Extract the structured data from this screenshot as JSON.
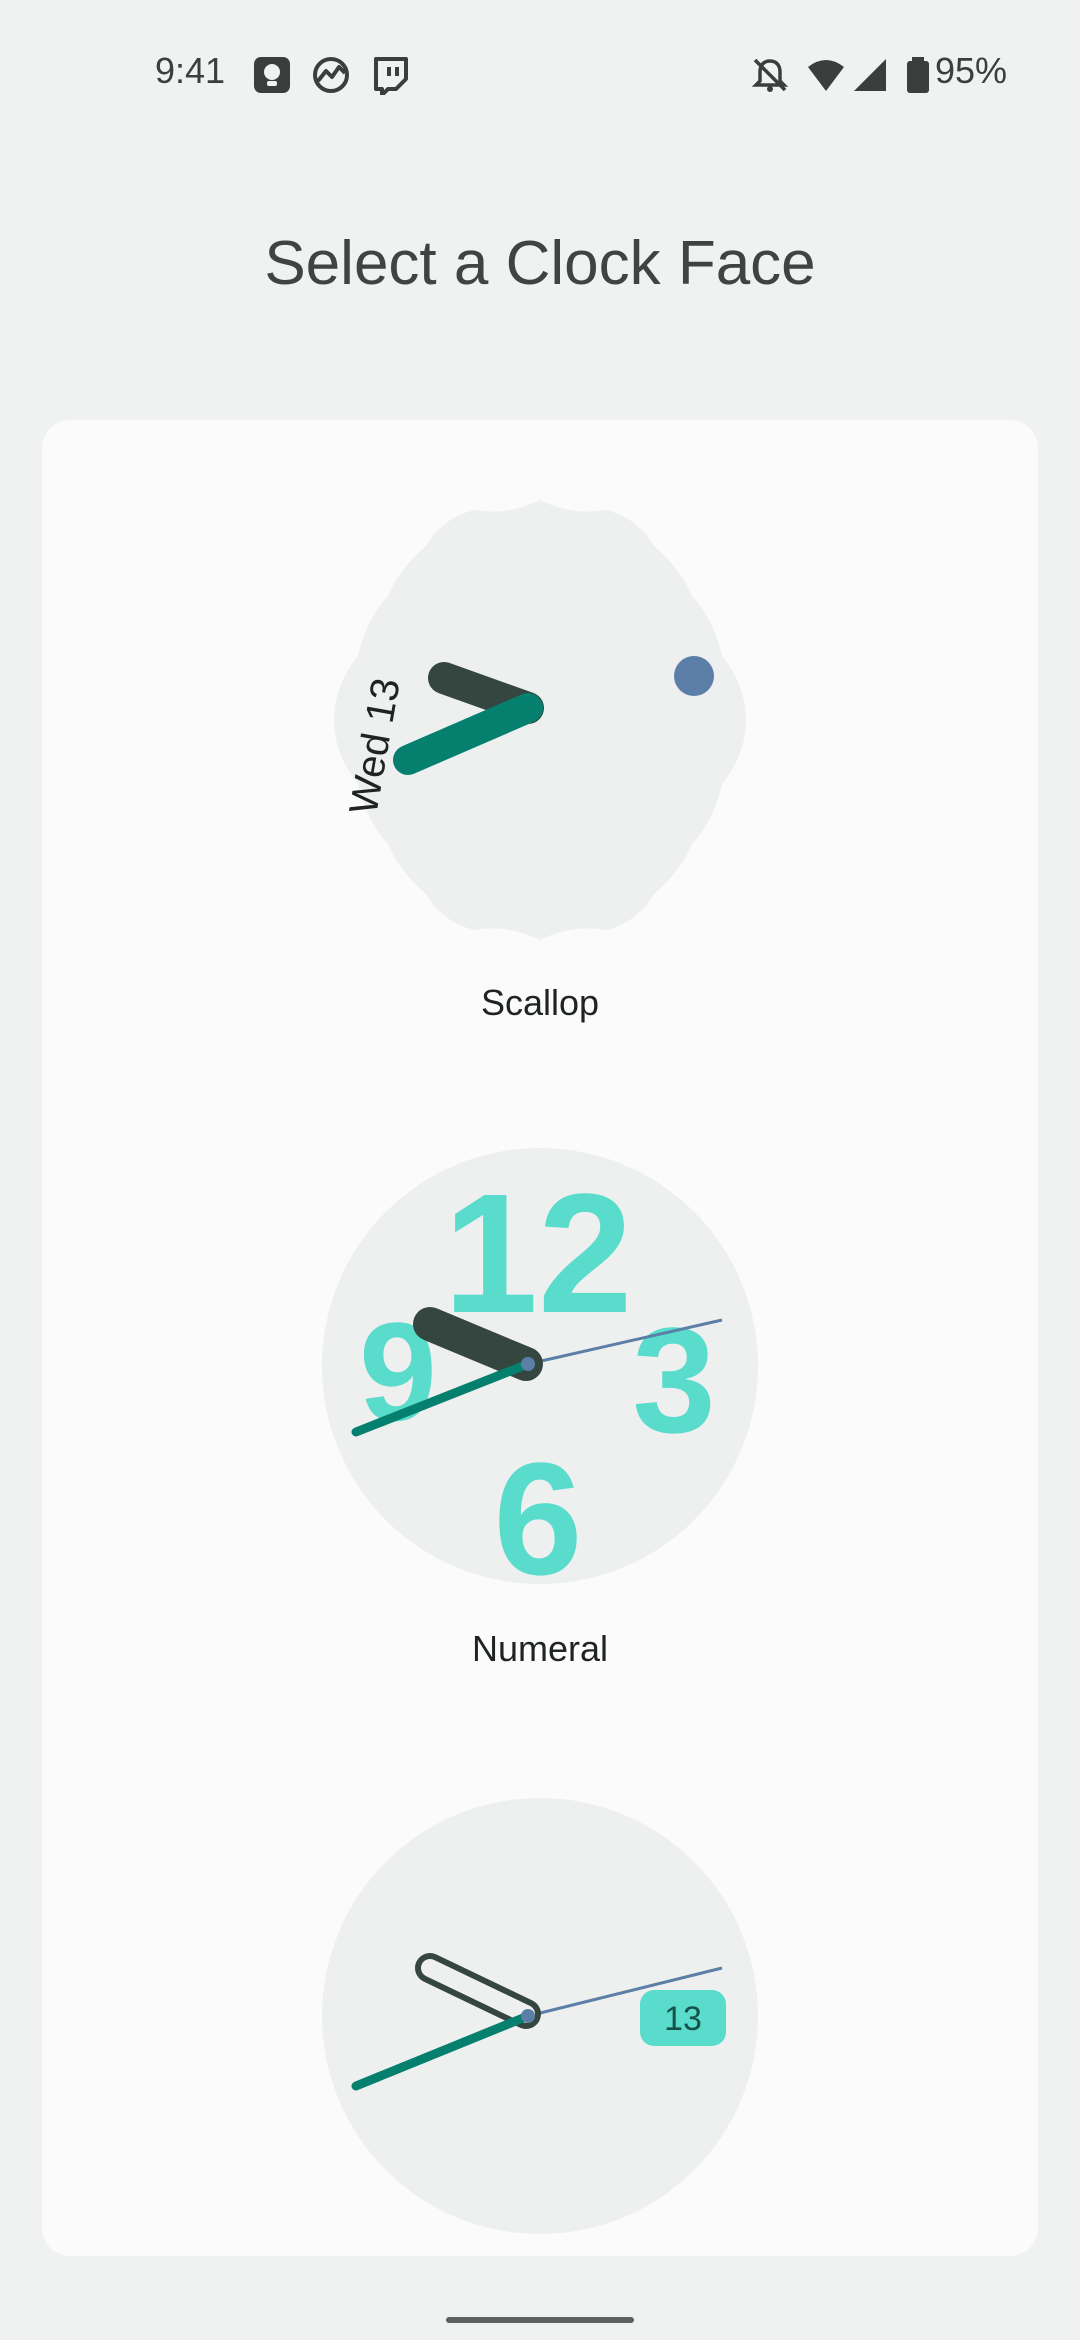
{
  "status_bar": {
    "time": "9:41",
    "battery": "95%",
    "left_icons": [
      "assistant-icon",
      "activity-icon",
      "twitch-icon"
    ],
    "right_icons": [
      "notifications-off-icon",
      "wifi-icon",
      "cell-signal-icon",
      "battery-icon"
    ]
  },
  "title": "Select a Clock Face",
  "clock_faces": [
    {
      "label": "Scallop",
      "date_text": "Wed 13"
    },
    {
      "label": "Numeral",
      "numerals": [
        "12",
        "3",
        "6",
        "9"
      ]
    },
    {
      "label": "",
      "date_badge": "13"
    }
  ],
  "colors": {
    "background": "#f0f1f1",
    "card": "#fafbfa",
    "clock_face": "#eef0f0",
    "hour_hand": "#34463f",
    "minute_hand": "#05806f",
    "accent_dot": "#5b7fa6",
    "numeral": "#5adccd"
  }
}
